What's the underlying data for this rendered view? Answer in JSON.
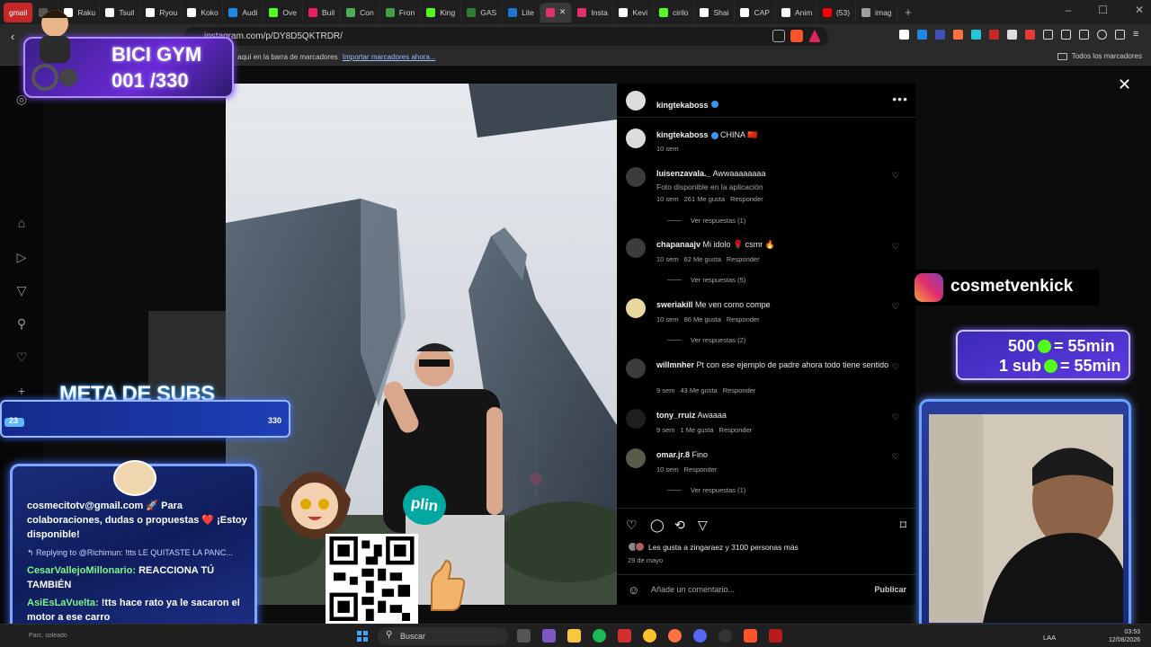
{
  "browser": {
    "tabs": [
      {
        "label": "gmail",
        "color": "#c62828"
      },
      {
        "label": "",
        "color": "#555555"
      },
      {
        "label": "Raku",
        "color": "#ffffff"
      },
      {
        "label": "Tsuil",
        "color": "#ffffff"
      },
      {
        "label": "Ryou",
        "color": "#ffffff"
      },
      {
        "label": "Koko",
        "color": "#ffffff"
      },
      {
        "label": "Audi",
        "color": "#1e88e5"
      },
      {
        "label": "Ove",
        "color": "#53fc18"
      },
      {
        "label": "Buil",
        "color": "#e91e63"
      },
      {
        "label": "Con",
        "color": "#4caf50"
      },
      {
        "label": "Fron",
        "color": "#43a047"
      },
      {
        "label": "King",
        "color": "#53fc18"
      },
      {
        "label": "GAS",
        "color": "#2e7d32"
      },
      {
        "label": "Lite",
        "color": "#1976d2"
      },
      {
        "label": "Insta",
        "color": "#e1306c"
      },
      {
        "label": "Kevi",
        "color": "#ffffff"
      },
      {
        "label": "cirilo",
        "color": "#53fc18"
      },
      {
        "label": "Shai",
        "color": "#ffffff"
      },
      {
        "label": "CAP",
        "color": "#ffffff"
      },
      {
        "label": "Anim",
        "color": "#ffffff"
      },
      {
        "label": "(53)",
        "color": "#ff0000"
      },
      {
        "label": "imag",
        "color": "#9e9e9e"
      }
    ],
    "url": "instagram.com/p/DY8D5QKTRDR/",
    "bookmarks_text": "aquí en la barra de marcadores",
    "bookmarks_import": "Importar marcadores ahora...",
    "bookmarks_all": "Todos los marcadores"
  },
  "post": {
    "author": "kingtekaboss",
    "caption": "CHINA 🇨🇳",
    "caption_time": "10 sem",
    "comments": [
      {
        "user": "luisenzavala._",
        "text": "Awwaaaaaaaa",
        "sub": "Foto disponible en la aplicación",
        "time": "10 sem",
        "likes": "261 Me gusta",
        "reply": "Responder",
        "replies": "Ver respuestas (1)"
      },
      {
        "user": "chapanaajv",
        "text": "Mi idolo 🌹 csmr 🔥",
        "time": "10 sem",
        "likes": "62 Me gusta",
        "reply": "Responder",
        "replies": "Ver respuestas (5)"
      },
      {
        "user": "sweriakill",
        "text": "Me ven como compe",
        "time": "10 sem",
        "likes": "86 Me gusta",
        "reply": "Responder",
        "replies": "Ver respuestas (2)"
      },
      {
        "user": "willmnher",
        "text": "Pt con ese ejemplo de padre ahora todo tiene sentido",
        "time": "9 sem",
        "likes": "43 Me gusta",
        "reply": "Responder"
      },
      {
        "user": "tony_rruiz",
        "text": "Awaaaa",
        "time": "9 sem",
        "likes": "1 Me gusta",
        "reply": "Responder"
      },
      {
        "user": "omar.jr.8",
        "text": "Fino",
        "time": "10 sem",
        "reply": "Responder",
        "replies": "Ver respuestas (1)"
      }
    ],
    "likes_text": "Les gusta a zingaraez y 3100 personas más",
    "date": "29 de mayo",
    "add_comment_placeholder": "Añade un comentario...",
    "publish": "Publicar"
  },
  "overlays": {
    "bici_title": "BICI GYM",
    "bici_count": "001 /330",
    "meta_title": "META DE SUBS",
    "meta_current": "23",
    "meta_goal": "330",
    "meta_progress": 0.07,
    "chat": {
      "line1": "cosmecitotv@gmail.com 🚀 Para colaboraciones, dudas o propuestas ❤️ ¡Estoy disponible!",
      "reply_hint": "↰ Replying to @Richimun: !tts LE QUITASTE LA PANC...",
      "user2": "CesarVallejoMillonario:",
      "msg2": "REACCIONA TÚ TAMBIÉN",
      "user3": "AsiEsLaVuelta:",
      "msg3": "!tts hace rato ya le sacaron el motor a ese carro"
    },
    "plin": "plin",
    "instagram_handle": "cosmetvenkick",
    "kick_line1": "500",
    "kick_line1_tail": "= 55min",
    "kick_line2": "1 sub",
    "kick_line2_tail": "= 55min"
  },
  "taskbar": {
    "search": "Buscar",
    "status": "Parc. soleado",
    "lang": "LAA",
    "time": "03:53",
    "date": "12/08/2026"
  },
  "colors": {
    "instagram_bg": "#000000",
    "verified": "#3897f0",
    "kick_green": "#53fc18",
    "overlay_blue": "#1e3fb7"
  }
}
